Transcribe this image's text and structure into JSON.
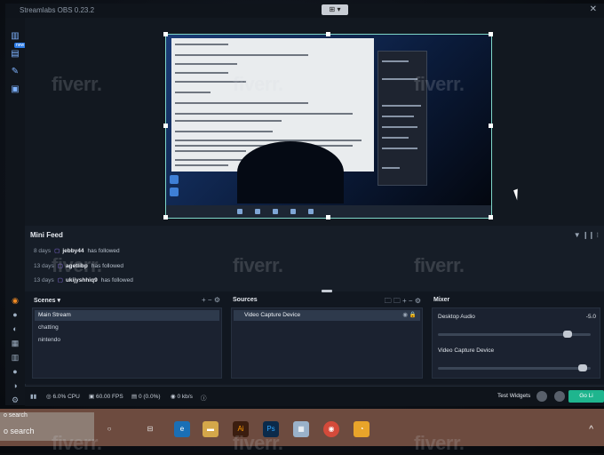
{
  "app": {
    "title": "Streamlabs OBS 0.23.2",
    "close": "✕",
    "center_control": "⊞ ▾"
  },
  "mini_feed": {
    "title": "Mini Feed",
    "controls": "▼  ❙❙  ⁝",
    "items": [
      {
        "days": "8 days",
        "user": "jebby44",
        "action": "has followed"
      },
      {
        "days": "13 days",
        "user": "agetlibp",
        "action": "has followed"
      },
      {
        "days": "13 days",
        "user": "ukijyshhiq9",
        "action": "has followed"
      }
    ]
  },
  "scenes": {
    "title": "Scenes",
    "controls": "+ − ⚙",
    "items": [
      "Main Stream",
      "chatting",
      "nintendo"
    ],
    "active": "Main Stream"
  },
  "sources": {
    "title": "Sources",
    "controls": "🗀 🗀 + − ⚙",
    "items": [
      "Video Capture Device"
    ]
  },
  "mixer": {
    "title": "Mixer",
    "channels": [
      {
        "name": "Desktop Audio",
        "value": "-5.0",
        "level": 0.85
      },
      {
        "name": "Video Capture Device",
        "value": "",
        "level": 0.95
      }
    ]
  },
  "statusbar": {
    "cpu": "6.0% CPU",
    "fps": "60.00 FPS",
    "dropped": "0 (0.0%)",
    "bitrate": "0 kb/s",
    "test_widgets": "Test Widgets",
    "go_live": "Go Li"
  },
  "taskbar": {
    "search_hint": "o search",
    "search_text": "o search",
    "apps": [
      "task-view",
      "edge",
      "file-explorer",
      "illustrator",
      "photoshop",
      "files",
      "chrome",
      "streamlabs"
    ]
  },
  "watermark": "fiverr.",
  "colors": {
    "accent": "#1fb58e",
    "twitch": "#9b7cff",
    "bg": "#151b24"
  }
}
